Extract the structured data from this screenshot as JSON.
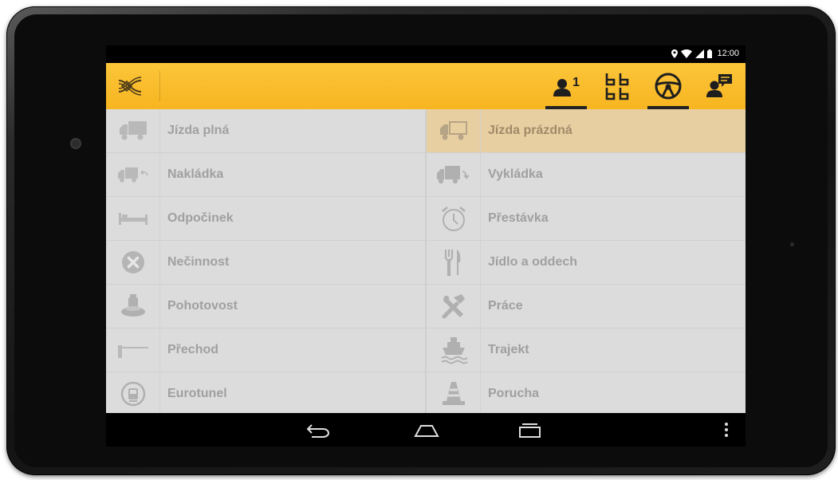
{
  "status_bar": {
    "time": "12:00",
    "icons": [
      "location-icon",
      "wifi-icon",
      "signal-icon",
      "battery-icon"
    ]
  },
  "app_bar": {
    "logo_icon": "route-logo-icon",
    "buttons": [
      {
        "name": "driver-one-button",
        "icon": "driver-icon",
        "badge": "1",
        "active": true
      },
      {
        "name": "crew-button",
        "icon": "crew-grid-icon",
        "active": false
      },
      {
        "name": "driving-button",
        "icon": "steering-wheel-icon",
        "active": true
      },
      {
        "name": "messages-button",
        "icon": "driver-message-icon",
        "active": false
      }
    ]
  },
  "activities": {
    "left": [
      {
        "label": "Jízda plná",
        "icon": "truck-full-icon"
      },
      {
        "label": "Nakládka",
        "icon": "truck-loading-icon"
      },
      {
        "label": "Odpočinek",
        "icon": "bed-icon"
      },
      {
        "label": "Nečinnost",
        "icon": "cancel-circle-icon"
      },
      {
        "label": "Pohotovost",
        "icon": "standby-bell-icon"
      },
      {
        "label": "Přechod",
        "icon": "border-barrier-icon"
      },
      {
        "label": "Eurotunel",
        "icon": "tunnel-train-icon"
      }
    ],
    "right": [
      {
        "label": "Jízda prázdná",
        "icon": "truck-empty-icon",
        "selected": true
      },
      {
        "label": "Vykládka",
        "icon": "truck-unloading-icon"
      },
      {
        "label": "Přestávka",
        "icon": "alarm-clock-icon"
      },
      {
        "label": "Jídlo a oddech",
        "icon": "fork-knife-icon"
      },
      {
        "label": "Práce",
        "icon": "tools-icon"
      },
      {
        "label": "Trajekt",
        "icon": "ferry-icon"
      },
      {
        "label": "Porucha",
        "icon": "traffic-cone-icon"
      }
    ]
  },
  "nav_bar": {
    "buttons": [
      "back-icon",
      "home-icon",
      "recents-icon",
      "overflow-menu-icon"
    ]
  },
  "colors": {
    "accent": "#f9bd2c",
    "selected_row": "#e8cfa2",
    "list_bg": "#dcdcdc",
    "text": "#a0a0a0"
  }
}
